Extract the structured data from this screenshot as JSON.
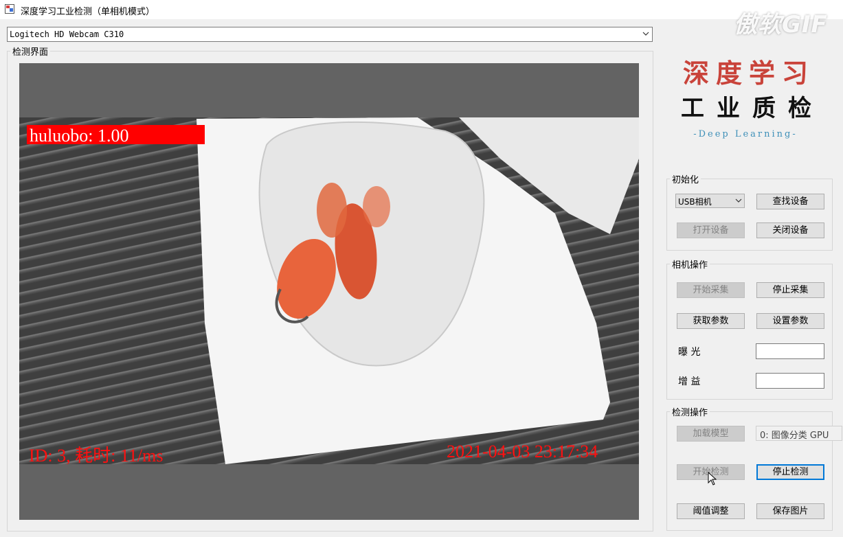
{
  "window": {
    "title": "深度学习工业检测（单相机模式）",
    "watermark": "傲软GIF"
  },
  "device_select": {
    "value": "Logitech HD Webcam C310"
  },
  "detection_view": {
    "group_title": "检测界面",
    "detection_label": "huluobo: 1.00",
    "overlay_left": "ID: 3, 耗时: 11/ms",
    "overlay_right": "2021-04-03  23:17:34"
  },
  "logo": {
    "line1": "深度学习",
    "line2": "工业质检",
    "line3": "-Deep Learning-"
  },
  "init_group": {
    "title": "初始化",
    "camera_type": "USB相机",
    "find_device": "查找设备",
    "open_device": "打开设备",
    "close_device": "关闭设备"
  },
  "camera_group": {
    "title": "相机操作",
    "start_capture": "开始采集",
    "stop_capture": "停止采集",
    "get_params": "获取参数",
    "set_params": "设置参数",
    "exposure_label": "曝   光",
    "gain_label": "增   益",
    "exposure_value": "",
    "gain_value": ""
  },
  "detect_group": {
    "title": "检测操作",
    "load_model": "加载模型",
    "model_value": "0: 图像分类 GPU",
    "start_detect": "开始检测",
    "stop_detect": "停止检测",
    "threshold": "阈值调整",
    "save_image": "保存图片"
  },
  "colors": {
    "label_red": "#ff0000",
    "logo_red": "#c9433a",
    "logo_blue": "#3d8fb8",
    "focus_blue": "#0078d7"
  },
  "icons": [
    "app-icon",
    "chevron-down-icon",
    "mouse-cursor-icon"
  ]
}
